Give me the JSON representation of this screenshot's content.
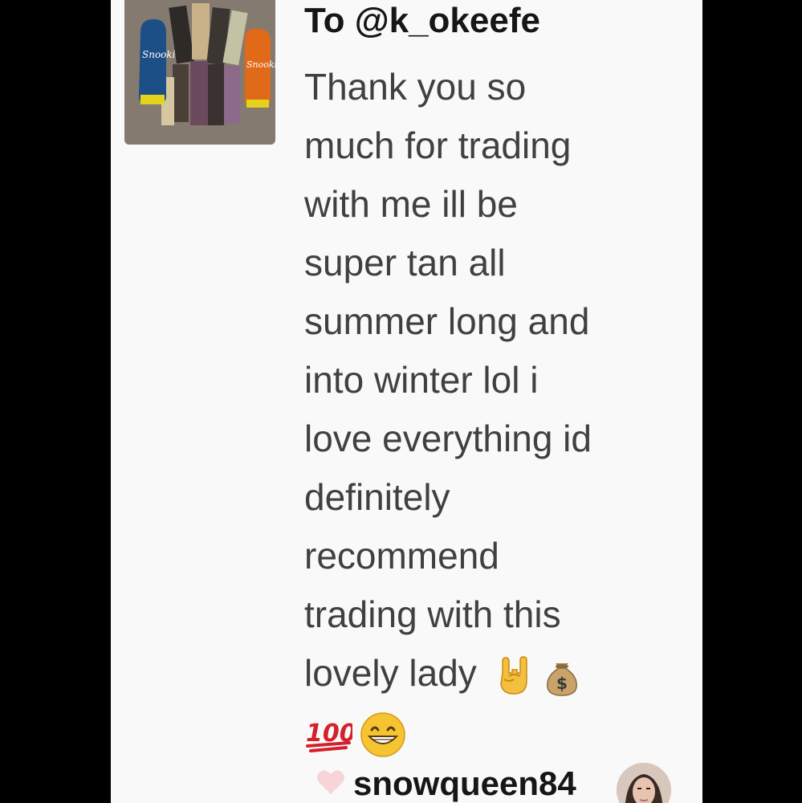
{
  "message": {
    "title": "To @k_okeefe",
    "lines": [
      "Thank you so",
      "much for trading",
      "with me ill be",
      "super tan all",
      "summer long and",
      "into winter lol i",
      "love everything id",
      "definitely",
      "recommend",
      "trading with this",
      "lovely lady"
    ],
    "emojis": [
      "rock-on-hand-emoji",
      "money-bag-emoji",
      "hundred-points-emoji",
      "grinning-face-emoji"
    ]
  },
  "thumbnail": {
    "icon": "tanning-products-photo"
  },
  "footer": {
    "username": "snowqueen84",
    "heart_icon": "heart-icon",
    "avatar": "avatar-photo"
  },
  "colors": {
    "background": "#000000",
    "panel": "#f9f9f9",
    "text": "#404040",
    "heading": "#161616",
    "heart": "#f7d3da"
  }
}
